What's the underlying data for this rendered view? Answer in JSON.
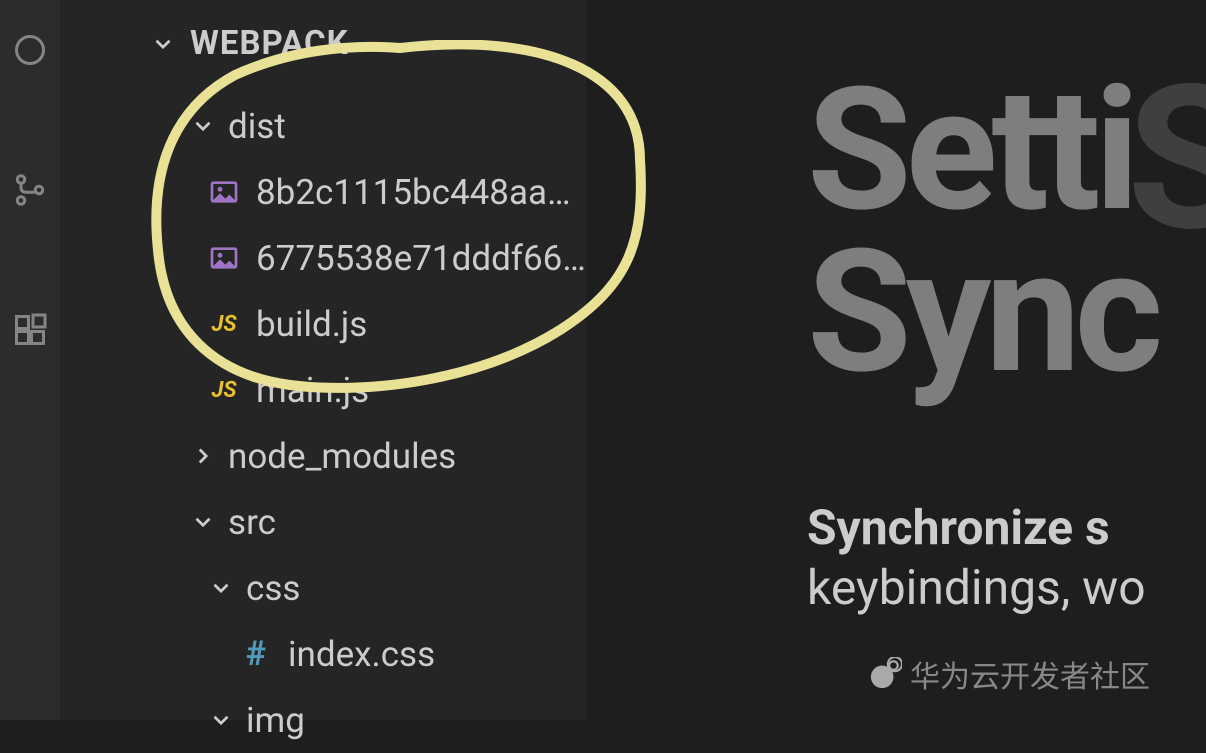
{
  "explorer": {
    "title": "WEBPACK",
    "tree": {
      "dist": {
        "label": "dist",
        "expanded": true,
        "children": {
          "img1": "8b2c1115bc448aa84…",
          "img2": "6775538e71dddf662…",
          "buildjs": "build.js",
          "mainjs": "main.js"
        }
      },
      "node_modules": {
        "label": "node_modules",
        "expanded": false
      },
      "src": {
        "label": "src",
        "expanded": true,
        "css": {
          "label": "css",
          "expanded": true,
          "indexcss": "index.css"
        },
        "img": {
          "label": "img",
          "expanded": true
        }
      }
    }
  },
  "editor": {
    "title1": "Setti",
    "title2": "Sync",
    "overlay_letter": "S",
    "desc_line1": "Synchronize s",
    "desc_line2": "keybindings, wo"
  },
  "watermark": "华为云开发者社区"
}
